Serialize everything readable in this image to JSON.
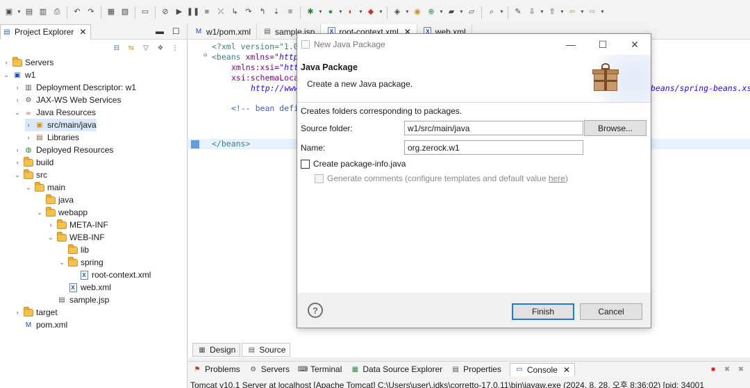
{
  "toolbar": {
    "icons": [
      "new-icon",
      "save-icon",
      "save-all-icon",
      "print-icon",
      "undo-icon",
      "redo-icon",
      "build-icon",
      "build-all-icon",
      "terminal-icon",
      "skip-breakpoints-icon",
      "resume-icon",
      "suspend-icon",
      "terminate-icon",
      "disconnect-icon",
      "step-into-icon",
      "step-over-icon",
      "step-return-icon",
      "drop-to-frame-icon",
      "use-step-filters-icon",
      "debug-icon",
      "run-icon",
      "coverage-icon",
      "external-tools-icon",
      "new-java-project-icon",
      "new-package-icon",
      "new-class-icon",
      "open-type-icon",
      "open-task-icon",
      "search-icon",
      "mark-occurrences-icon",
      "next-annotation-icon",
      "prev-annotation-icon",
      "back-icon",
      "forward-icon"
    ]
  },
  "project_explorer": {
    "tab_label": "Project Explorer",
    "tree": [
      {
        "label": "Servers",
        "depth": 0,
        "twisty": "closed",
        "icon": "folder"
      },
      {
        "label": "w1",
        "depth": 0,
        "twisty": "open",
        "icon": "project"
      },
      {
        "label": "Deployment Descriptor: w1",
        "depth": 1,
        "twisty": "closed",
        "icon": "descriptor"
      },
      {
        "label": "JAX-WS Web Services",
        "depth": 1,
        "twisty": "closed",
        "icon": "webservices"
      },
      {
        "label": "Java Resources",
        "depth": 1,
        "twisty": "open",
        "icon": "java-resources"
      },
      {
        "label": "src/main/java",
        "depth": 2,
        "twisty": "closed",
        "icon": "package-root",
        "selected": true
      },
      {
        "label": "Libraries",
        "depth": 2,
        "twisty": "closed",
        "icon": "libraries"
      },
      {
        "label": "Deployed Resources",
        "depth": 1,
        "twisty": "closed",
        "icon": "deployed"
      },
      {
        "label": "build",
        "depth": 1,
        "twisty": "closed",
        "icon": "folder"
      },
      {
        "label": "src",
        "depth": 1,
        "twisty": "open",
        "icon": "folder"
      },
      {
        "label": "main",
        "depth": 2,
        "twisty": "open",
        "icon": "folder"
      },
      {
        "label": "java",
        "depth": 3,
        "twisty": "none",
        "icon": "folder"
      },
      {
        "label": "webapp",
        "depth": 3,
        "twisty": "open",
        "icon": "folder"
      },
      {
        "label": "META-INF",
        "depth": 4,
        "twisty": "closed",
        "icon": "folder"
      },
      {
        "label": "WEB-INF",
        "depth": 4,
        "twisty": "open",
        "icon": "folder"
      },
      {
        "label": "lib",
        "depth": 5,
        "twisty": "none",
        "icon": "folder"
      },
      {
        "label": "spring",
        "depth": 5,
        "twisty": "open",
        "icon": "folder"
      },
      {
        "label": "root-context.xml",
        "depth": 6,
        "twisty": "none",
        "icon": "xml"
      },
      {
        "label": "web.xml",
        "depth": 5,
        "twisty": "none",
        "icon": "xml"
      },
      {
        "label": "sample.jsp",
        "depth": 4,
        "twisty": "none",
        "icon": "jsp"
      },
      {
        "label": "target",
        "depth": 1,
        "twisty": "closed",
        "icon": "folder"
      },
      {
        "label": "pom.xml",
        "depth": 1,
        "twisty": "none",
        "icon": "maven"
      }
    ]
  },
  "editor": {
    "tabs": [
      {
        "label": "w1/pom.xml",
        "icon": "maven-icon",
        "active": false
      },
      {
        "label": "sample.jsp",
        "icon": "jsp-icon",
        "active": false
      },
      {
        "label": "root-context.xml",
        "icon": "xml-file-icon",
        "active": true,
        "closable": true
      },
      {
        "label": "web.xml",
        "icon": "xml-file-icon",
        "active": false
      }
    ],
    "lines": {
      "l1": "<?xml version=\"1.0",
      "l2a": "<beans ",
      "l2b": "xmlns=",
      "l2c": "\"http:",
      "l3a": "xmlns:xsi=",
      "l3b": "\"htt",
      "l4a": "xsi:schemaLoca",
      "l5a": "http://www",
      "l5b": "beans/spring-beans.xsd",
      "l6": "<!-- bean defi",
      "l7": "</beans>"
    },
    "bottom_tabs": [
      "Design",
      "Source"
    ]
  },
  "bottom_panel": {
    "tabs": [
      "Problems",
      "Servers",
      "Terminal",
      "Data Source Explorer",
      "Properties",
      "Console"
    ],
    "active_tab": "Console",
    "console_text": "Tomcat v10.1 Server at localhost [Apache Tomcat] C:\\Users\\user\\.jdks\\corretto-17.0.11\\bin\\javaw.exe  (2024. 8. 28. 오후 8:36:02) [pid: 34001"
  },
  "dialog": {
    "window_title": "New Java Package",
    "header_title": "Java Package",
    "header_subtitle": "Create a new Java package.",
    "description": "Creates folders corresponding to packages.",
    "source_folder_label": "Source folder:",
    "source_folder_value": "w1/src/main/java",
    "browse_label": "Browse...",
    "name_label": "Name:",
    "name_value": "org.zerock.w1",
    "create_package_info_label": "Create package-info.java",
    "create_package_info_checked": false,
    "generate_comments_label": "Generate comments (configure templates and default value ",
    "generate_comments_link": "here",
    "generate_comments_suffix": ")",
    "generate_comments_checked": false,
    "finish_label": "Finish",
    "cancel_label": "Cancel",
    "help_label": "?"
  }
}
